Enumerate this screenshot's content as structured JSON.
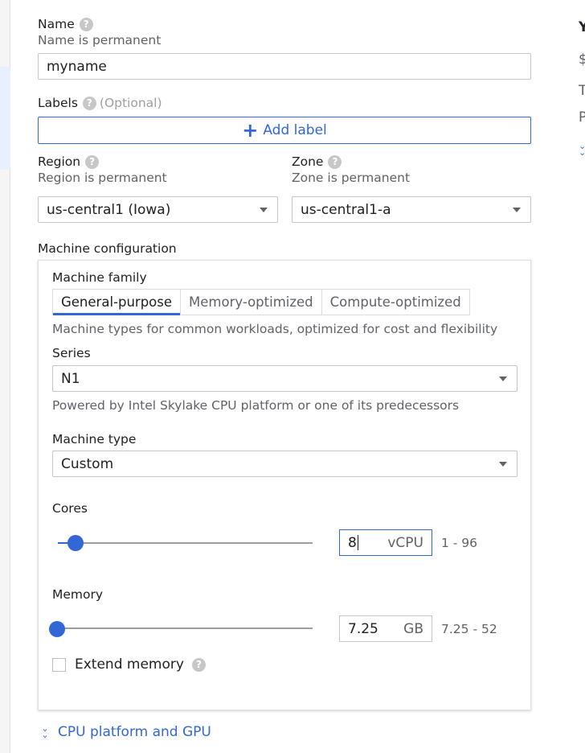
{
  "form": {
    "name_label": "Name",
    "name_sub": "Name is permanent",
    "name_value": "myname",
    "labels_label": "Labels",
    "labels_optional": "(Optional)",
    "add_label": "Add label",
    "region_label": "Region",
    "region_sub": "Region is permanent",
    "region_value": "us-central1 (Iowa)",
    "zone_label": "Zone",
    "zone_sub": "Zone is permanent",
    "zone_value": "us-central1-a",
    "machine_config_label": "Machine configuration"
  },
  "machine": {
    "family_label": "Machine family",
    "tabs": [
      "General-purpose",
      "Memory-optimized",
      "Compute-optimized"
    ],
    "active_tab": "General-purpose",
    "family_desc": "Machine types for common workloads, optimized for cost and flexibility",
    "series_label": "Series",
    "series_value": "N1",
    "series_desc": "Powered by Intel Skylake CPU platform or one of its predecessors",
    "type_label": "Machine type",
    "type_value": "Custom",
    "cores_label": "Cores",
    "cores_value": "8",
    "cores_unit": "vCPU",
    "cores_range": "1 - 96",
    "memory_label": "Memory",
    "memory_value": "7.25",
    "memory_unit": "GB",
    "memory_range": "7.25 - 52",
    "extend_memory_label": "Extend memory",
    "extend_memory_checked": false
  },
  "cpu_link": "CPU platform and GPU",
  "right_panel": {
    "line1": "Y",
    "line2": "$",
    "line3": "T",
    "line4": "P"
  },
  "colors": {
    "accent": "#3367d6",
    "help_icon": "#c7c7c7"
  }
}
